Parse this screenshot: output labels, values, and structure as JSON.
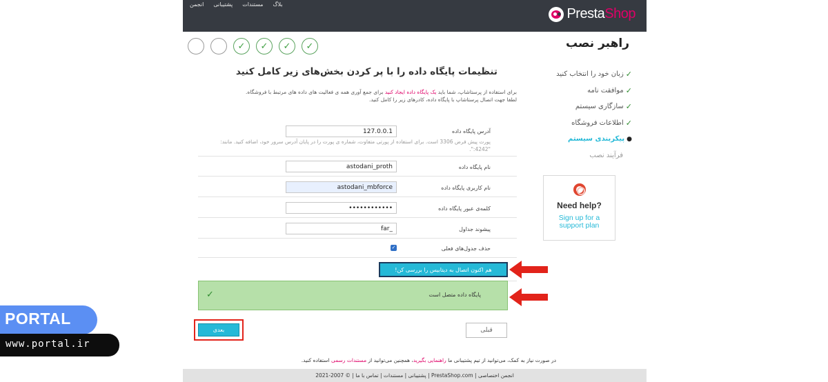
{
  "header": {
    "nav": [
      "انجمن",
      "پشتیبانی",
      "مستندات",
      "بلاگ"
    ],
    "logo_part1": "Presta",
    "logo_part2": "Shop",
    "colors": {
      "bar": "#363a41",
      "brand": "#df0067"
    }
  },
  "wizard": {
    "title": "راهبر نصب",
    "steps": [
      {
        "state": "done",
        "icon": "check-icon"
      },
      {
        "state": "done",
        "icon": "check-icon"
      },
      {
        "state": "done",
        "icon": "check-icon"
      },
      {
        "state": "done",
        "icon": "check-icon"
      },
      {
        "state": "pending",
        "icon": ""
      },
      {
        "state": "pending",
        "icon": ""
      }
    ],
    "check_glyph": "✓"
  },
  "sidebar": {
    "items": [
      {
        "label": "زبان خود را انتخاب کنید",
        "state": "done"
      },
      {
        "label": "موافقت نامه",
        "state": "done"
      },
      {
        "label": "سازگاری سیستم",
        "state": "done"
      },
      {
        "label": "اطلاعات فروشگاه",
        "state": "done"
      },
      {
        "label": "پیکربندی سیستم",
        "state": "active"
      },
      {
        "label": "فرآیند نصب",
        "state": "future"
      }
    ]
  },
  "help": {
    "title": "Need help?",
    "link_line1": "Sign up for a",
    "link_line2": "support plan"
  },
  "main": {
    "title": "تنظیمات پایگاه داده را با پر کردن بخش‌های زیر کامل کنید",
    "intro_before": "برای استفاده از پرستاشاپ، شما باید ",
    "intro_link": "یک پایگاه داده ایجاد کنید",
    "intro_after": " برای جمع آوری همه ی فعالیت های داده های مرتبط با فروشگاه.",
    "intro_line2": "لطفا جهت اتصال پرستاشاپ با پایگاه داده، کادرهای زیر را کامل کنید."
  },
  "form": {
    "server_label": "آدرس پایگاه داده",
    "server_value": "127.0.0.1",
    "server_hint": "پورت پیش فرض 3306 است. برای استفاده از پورتی متفاوت، شماره ی پورت را در پایان آدرس سرور خود، اضافه کنید. مانند: \"4242:\".",
    "dbname_label": "نام پایگاه داده",
    "dbname_value": "astodani_proth",
    "user_label": "نام کاربری پایگاه داده",
    "user_value": "astodani_mbforce",
    "pass_label": "کلمه‌ی عبور پایگاه داده",
    "pass_value": "••••••••••••",
    "prefix_label": "پیشوند جداول",
    "prefix_value": "_far",
    "drop_label": "حذف جدول‌های فعلی",
    "drop_checked": true
  },
  "actions": {
    "test_button": "هم اکنون اتصال به دیتابیس را بررسی کن!",
    "success_text": "پایگاه داده متصل است",
    "next_button": "بعدی",
    "prev_button": "قبلی"
  },
  "footnote": {
    "before": "در صورت نیاز به کمک، می‌توانید از تیم پشتیبانی ما ",
    "link1": "راهنمایی بگیرید",
    "middle": "، همچنین می‌توانید از ",
    "link2": "مستندات رسمی",
    "after": " استفاده کنید."
  },
  "footer": {
    "text": "انجمن اختصاصی | PrestaShop.com | پشتیبانی | مستندات | تماس با ما | © 2007-2021"
  },
  "watermark": {
    "brand": "PORTAL",
    "url": "www.portal.ir",
    "colors": {
      "brand_bg": "#5b8ff3",
      "url_bg": "#0d0d0d"
    }
  }
}
